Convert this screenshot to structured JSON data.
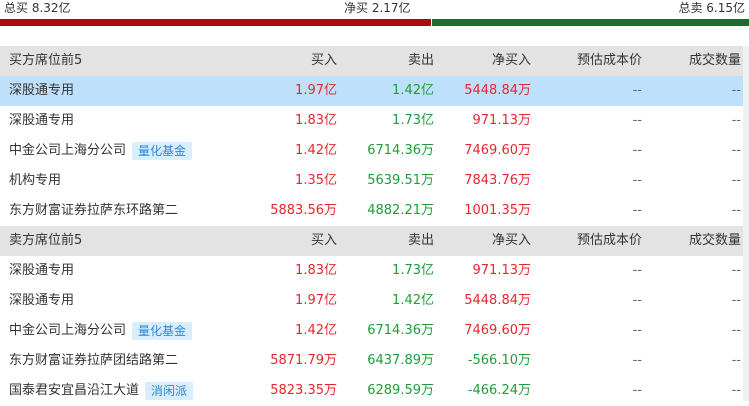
{
  "summary": {
    "total_buy": "总买 8.32亿",
    "net_buy": "净买 2.17亿",
    "total_sell": "总卖 6.15亿"
  },
  "buy_section": {
    "headers": [
      "买方席位前5",
      "买入",
      "卖出",
      "净买入",
      "预估成本价",
      "成交数量"
    ],
    "rows": [
      {
        "name": "深股通专用",
        "tag": "",
        "buy": "1.97亿",
        "sell": "1.42亿",
        "net": "5448.84万",
        "cost": "--",
        "qty": "--"
      },
      {
        "name": "深股通专用",
        "tag": "",
        "buy": "1.83亿",
        "sell": "1.73亿",
        "net": "971.13万",
        "cost": "--",
        "qty": "--"
      },
      {
        "name": "中金公司上海分公司",
        "tag": "量化基金",
        "buy": "1.42亿",
        "sell": "6714.36万",
        "net": "7469.60万",
        "cost": "--",
        "qty": "--"
      },
      {
        "name": "机构专用",
        "tag": "",
        "buy": "1.35亿",
        "sell": "5639.51万",
        "net": "7843.76万",
        "cost": "--",
        "qty": "--"
      },
      {
        "name": "东方财富证券拉萨东环路第二",
        "tag": "",
        "buy": "5883.56万",
        "sell": "4882.21万",
        "net": "1001.35万",
        "cost": "--",
        "qty": "--"
      }
    ]
  },
  "sell_section": {
    "headers": [
      "卖方席位前5",
      "买入",
      "卖出",
      "净买入",
      "预估成本价",
      "成交数量"
    ],
    "rows": [
      {
        "name": "深股通专用",
        "tag": "",
        "buy": "1.83亿",
        "sell": "1.73亿",
        "net": "971.13万",
        "cost": "--",
        "qty": "--"
      },
      {
        "name": "深股通专用",
        "tag": "",
        "buy": "1.97亿",
        "sell": "1.42亿",
        "net": "5448.84万",
        "cost": "--",
        "qty": "--"
      },
      {
        "name": "中金公司上海分公司",
        "tag": "量化基金",
        "buy": "1.42亿",
        "sell": "6714.36万",
        "net": "7469.60万",
        "cost": "--",
        "qty": "--"
      },
      {
        "name": "东方财富证券拉萨团结路第二",
        "tag": "",
        "buy": "5871.79万",
        "sell": "6437.89万",
        "net": "-566.10万",
        "cost": "--",
        "qty": "--"
      },
      {
        "name": "国泰君安宜昌沿江大道",
        "tag": "消闲派",
        "buy": "5823.35万",
        "sell": "6289.59万",
        "net": "-466.24万",
        "cost": "--",
        "qty": "--"
      }
    ]
  },
  "colors": {
    "buy_red": "#e8262d",
    "sell_green": "#1e9e3a",
    "buy_bar": "#a50d12",
    "sell_bar": "#1a6d2f",
    "highlight_row": "#bfe0fb",
    "tag_bg": "#d9eefc",
    "tag_text": "#2a88d6"
  }
}
